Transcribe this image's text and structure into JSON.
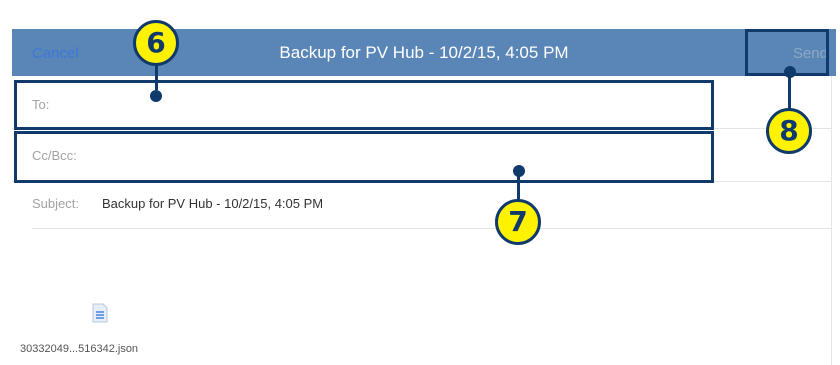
{
  "header": {
    "cancel_label": "Cancel",
    "title": "Backup for PV Hub - 10/2/15, 4:05 PM",
    "send_label": "Send"
  },
  "fields": {
    "to_label": "To:",
    "ccbcc_label": "Cc/Bcc:",
    "subject_label": "Subject:",
    "subject_value": "Backup for PV Hub - 10/2/15, 4:05 PM"
  },
  "attachment": {
    "filename": "30332049...516342.json",
    "icon": "document-icon"
  },
  "callouts": {
    "to_field": "6",
    "cc_field": "7",
    "send_button": "8"
  },
  "colors": {
    "header_bg": "#5a86b7",
    "highlight": "#0f3a6b",
    "callout_fill": "#fff200"
  }
}
